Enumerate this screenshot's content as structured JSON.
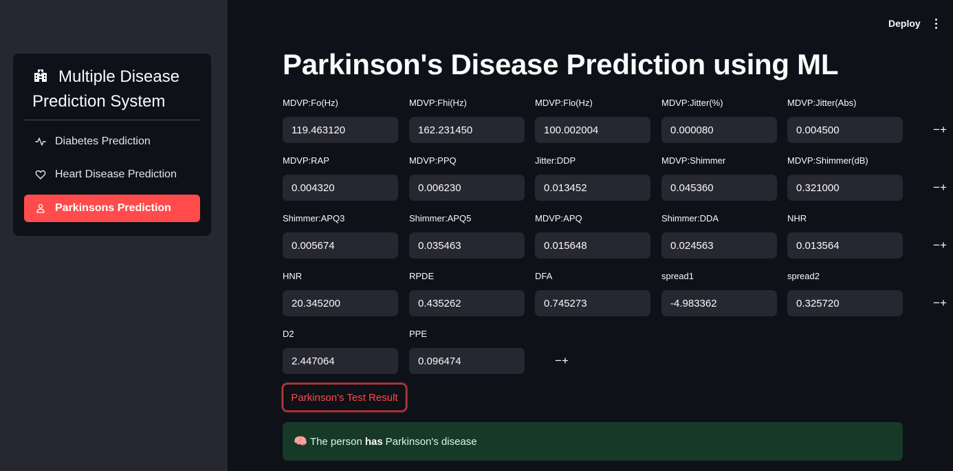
{
  "header": {
    "deploy_label": "Deploy",
    "more_icon": "kebab-menu-icon"
  },
  "sidebar": {
    "title": "Multiple Disease Prediction System",
    "title_icon": "hospital-icon",
    "items": [
      {
        "label": "Diabetes Prediction",
        "icon": "activity-icon",
        "active": false
      },
      {
        "label": "Heart Disease Prediction",
        "icon": "heart-icon",
        "active": false
      },
      {
        "label": "Parkinsons Prediction",
        "icon": "person-icon",
        "active": true
      }
    ]
  },
  "main": {
    "title": "Parkinson's Disease Prediction using ML",
    "fields": [
      {
        "label": "MDVP:Fo(Hz)",
        "value": "119.463120"
      },
      {
        "label": "MDVP:Fhi(Hz)",
        "value": "162.231450"
      },
      {
        "label": "MDVP:Flo(Hz)",
        "value": "100.002004"
      },
      {
        "label": "MDVP:Jitter(%)",
        "value": "0.000080"
      },
      {
        "label": "MDVP:Jitter(Abs)",
        "value": "0.004500"
      },
      {
        "label": "MDVP:RAP",
        "value": "0.004320"
      },
      {
        "label": "MDVP:PPQ",
        "value": "0.006230"
      },
      {
        "label": "Jitter:DDP",
        "value": "0.013452"
      },
      {
        "label": "MDVP:Shimmer",
        "value": "0.045360"
      },
      {
        "label": "MDVP:Shimmer(dB)",
        "value": "0.321000"
      },
      {
        "label": "Shimmer:APQ3",
        "value": "0.005674"
      },
      {
        "label": "Shimmer:APQ5",
        "value": "0.035463"
      },
      {
        "label": "MDVP:APQ",
        "value": "0.015648"
      },
      {
        "label": "Shimmer:DDA",
        "value": "0.024563"
      },
      {
        "label": "NHR",
        "value": "0.013564"
      },
      {
        "label": "HNR",
        "value": "20.345200"
      },
      {
        "label": "RPDE",
        "value": "0.435262"
      },
      {
        "label": "DFA",
        "value": "0.745273"
      },
      {
        "label": "spread1",
        "value": "-4.983362"
      },
      {
        "label": "spread2",
        "value": "0.325720"
      },
      {
        "label": "D2",
        "value": "2.447064"
      },
      {
        "label": "PPE",
        "value": "0.096474"
      }
    ],
    "stepper": {
      "minus": "−",
      "plus": "+"
    },
    "result_button_label": "Parkinson's Test Result",
    "result": {
      "emoji": "🧠",
      "prefix": "The person",
      "emphasis": "has",
      "suffix": "Parkinson's disease",
      "color": "#173928"
    }
  },
  "colors": {
    "accent": "#ff4b4b",
    "background": "#0e1117",
    "sidebar": "#262730",
    "input": "#262730"
  }
}
